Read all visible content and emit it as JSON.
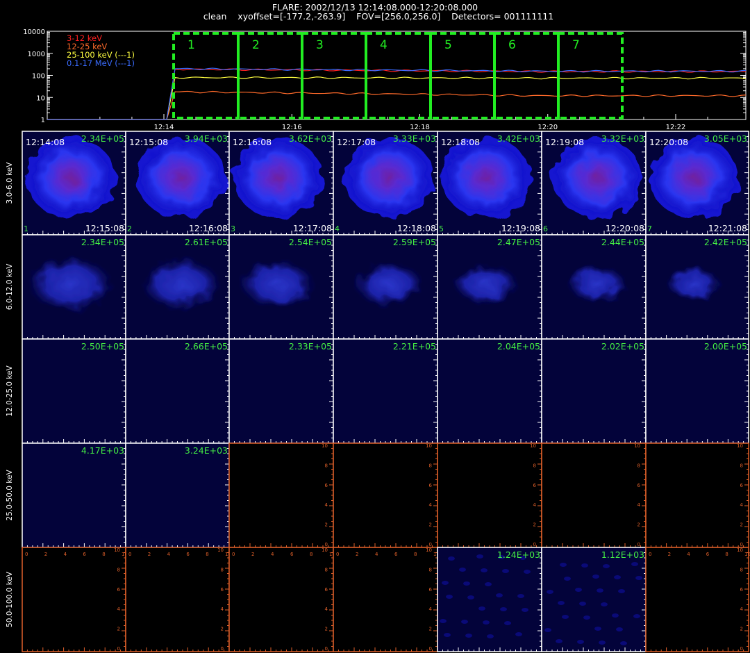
{
  "header": {
    "title": "FLARE: 2002/12/13 12:14:08.000-12:20:08.000",
    "subtitle": "clean    xyoffset=[-177.2,-263.9]    FOV=[256.0,256.0]    Detectors= 001111111"
  },
  "chart_data": [
    {
      "type": "line",
      "name": "lightcurve",
      "yscale": "log",
      "ylim": [
        1,
        10000
      ],
      "yticks": [
        "1",
        "10",
        "100",
        "1000",
        "10000"
      ],
      "xtick_labels": [
        "12:14",
        "12:16",
        "12:18",
        "12:20",
        "12:22"
      ],
      "legend": [
        {
          "label": "3-12 keV",
          "color": "#ff2020"
        },
        {
          "label": "12-25 keV",
          "color": "#ff6a2a"
        },
        {
          "label": "25-100 keV (---1)",
          "color": "#ffff40"
        },
        {
          "label": "0.1-17 MeV (---1)",
          "color": "#3a6cff"
        }
      ],
      "series": [
        {
          "name": "3-12 keV",
          "color": "#ff2020",
          "rise": 190,
          "level": 150
        },
        {
          "name": "12-25 keV",
          "color": "#ff6a2a",
          "rise": 18,
          "level": 12
        },
        {
          "name": "25-100 keV",
          "color": "#ffff40",
          "rise": 80,
          "level": 75
        },
        {
          "name": "0.1-17 MeV",
          "color": "#3a6cff",
          "rise": 200,
          "level": 155
        }
      ],
      "intervals": [
        "1",
        "2",
        "3",
        "4",
        "5",
        "6",
        "7"
      ],
      "interval_color": "#22ee22"
    },
    {
      "type": "heatmap",
      "name": "image-grid",
      "columns": [
        {
          "interval": "1",
          "start": "12:14:08",
          "end": "12:15:08"
        },
        {
          "interval": "2",
          "start": "12:15:08",
          "end": "12:16:08"
        },
        {
          "interval": "3",
          "start": "12:16:08",
          "end": "12:17:08"
        },
        {
          "interval": "4",
          "start": "12:17:08",
          "end": "12:18:08"
        },
        {
          "interval": "5",
          "start": "12:18:08",
          "end": "12:19:08"
        },
        {
          "interval": "6",
          "start": "12:19:08",
          "end": "12:20:08"
        },
        {
          "interval": "7",
          "start": "12:20:08",
          "end": "12:21:08"
        }
      ],
      "rows": [
        {
          "band": "3.0-6.0 keV",
          "maxima": [
            "2.34E+05",
            "3.94E+03",
            "3.62E+03",
            "3.33E+03",
            "3.42E+03",
            "3.32E+03",
            "3.05E+03"
          ],
          "kind": [
            "bright",
            "bright",
            "bright",
            "bright",
            "bright",
            "bright",
            "bright"
          ]
        },
        {
          "band": "6.0-12.0 keV",
          "maxima": [
            "2.34E+05",
            "2.61E+05",
            "2.54E+05",
            "2.59E+05",
            "2.47E+05",
            "2.44E+05",
            "2.42E+05"
          ],
          "kind": [
            "dim",
            "dim",
            "dim",
            "dim",
            "dim",
            "dim",
            "dim"
          ]
        },
        {
          "band": "12.0-25.0 keV",
          "maxima": [
            "2.50E+05",
            "2.66E+05",
            "2.33E+05",
            "2.21E+05",
            "2.04E+05",
            "2.02E+05",
            "2.00E+05"
          ],
          "kind": [
            "flat",
            "flat",
            "flat",
            "flat",
            "flat",
            "flat",
            "flat"
          ]
        },
        {
          "band": "25.0-50.0 keV",
          "maxima": [
            "4.17E+03",
            "3.24E+03",
            "",
            "",
            "",
            "",
            ""
          ],
          "kind": [
            "flat",
            "flat",
            "empty",
            "empty",
            "empty",
            "empty",
            "empty"
          ]
        },
        {
          "band": "50.0-100.0 keV",
          "maxima": [
            "",
            "",
            "",
            "",
            "1.24E+03",
            "1.12E+03",
            ""
          ],
          "kind": [
            "empty",
            "empty",
            "empty",
            "empty",
            "noise",
            "noise",
            "empty"
          ]
        }
      ],
      "empty_ticks": [
        "0",
        "2",
        "4",
        "6",
        "8",
        "10"
      ]
    }
  ]
}
